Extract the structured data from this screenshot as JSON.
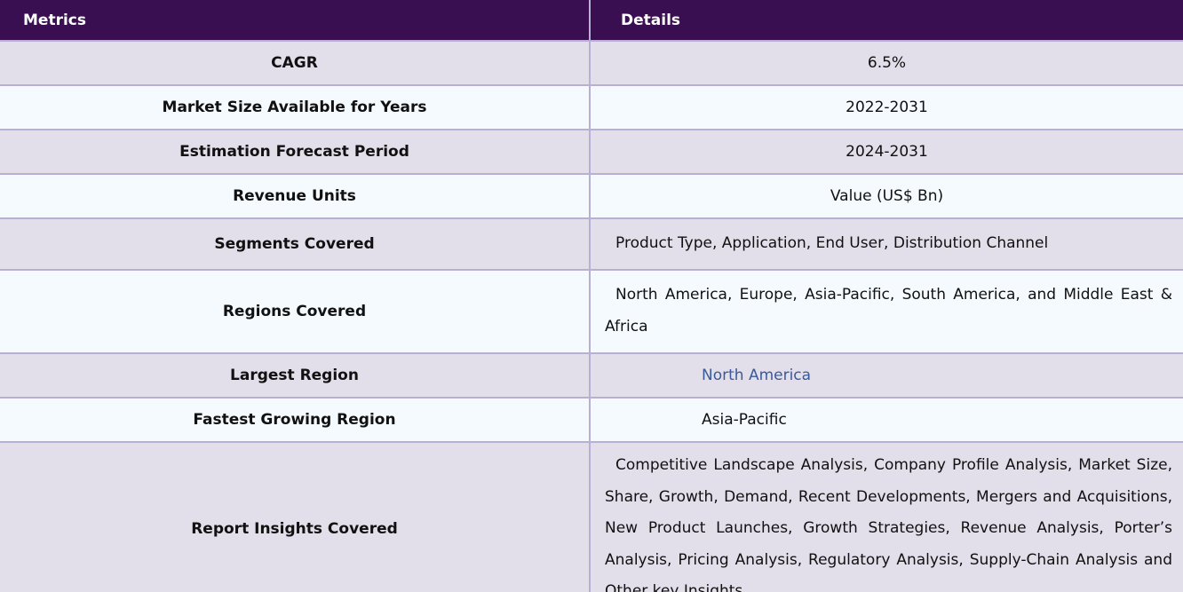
{
  "table": {
    "headers": [
      "Metrics",
      "Details"
    ],
    "rows": [
      {
        "metric": "CAGR",
        "detail": "6.5%"
      },
      {
        "metric": "Market Size Available for Years",
        "detail": "2022-2031"
      },
      {
        "metric": "Estimation Forecast Period",
        "detail": "2024-2031"
      },
      {
        "metric": "Revenue Units",
        "detail": "Value (US$ Bn)"
      },
      {
        "metric": "Segments Covered",
        "detail": "Product Type, Application, End User, Distribution Channel"
      },
      {
        "metric": "Regions Covered",
        "detail": "North America, Europe, Asia-Pacific, South America, and Middle East & Africa"
      },
      {
        "metric": "Largest Region",
        "detail": "North America"
      },
      {
        "metric": "Fastest Growing Region",
        "detail": "Asia-Pacific"
      },
      {
        "metric": "Report Insights Covered",
        "detail": "Competitive Landscape Analysis, Company Profile Analysis, Market Size, Share, Growth, Demand, Recent Developments, Mergers and Acquisitions, New Product Launches, Growth Strategies, Revenue Analysis, Porter’s Analysis, Pricing Analysis, Regulatory Analysis, Supply-Chain Analysis and Other key Insights."
      }
    ]
  },
  "colors": {
    "header_bg": "#3a0f52",
    "row_alt_bg": "#e2deea",
    "row_bg": "#f5fafe",
    "link": "#3b5a98"
  }
}
